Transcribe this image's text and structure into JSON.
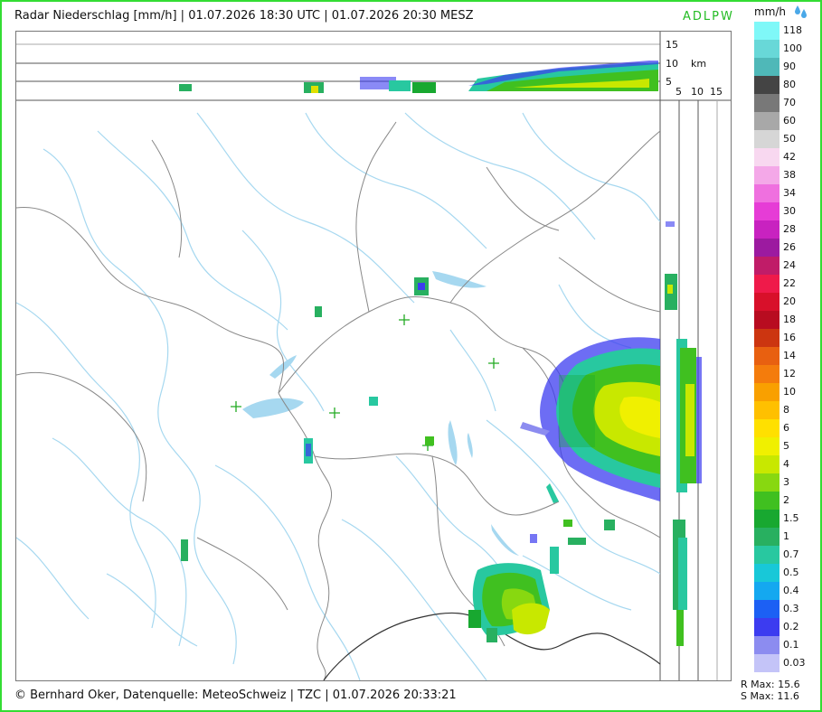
{
  "header": {
    "title": "Radar Niederschlag [mm/h] | 01.07.2026 18:30 UTC | 01.07.2026 20:30 MESZ",
    "brand": "ADLPW"
  },
  "legend": {
    "unit": "mm/h",
    "icon": "raindrops-icon",
    "entries": [
      {
        "label": "118",
        "color": "#7ff8f8"
      },
      {
        "label": "100",
        "color": "#68d8d8"
      },
      {
        "label": "90",
        "color": "#4fb8b8"
      },
      {
        "label": "80",
        "color": "#444444"
      },
      {
        "label": "70",
        "color": "#787878"
      },
      {
        "label": "60",
        "color": "#a8a8a8"
      },
      {
        "label": "50",
        "color": "#d6d6d6"
      },
      {
        "label": "42",
        "color": "#f8d8f0"
      },
      {
        "label": "38",
        "color": "#f4a8e8"
      },
      {
        "label": "34",
        "color": "#ef70df"
      },
      {
        "label": "30",
        "color": "#e63cd6"
      },
      {
        "label": "28",
        "color": "#c822c0"
      },
      {
        "label": "26",
        "color": "#9c1aa0"
      },
      {
        "label": "24",
        "color": "#c01c68"
      },
      {
        "label": "22",
        "color": "#ef1a4a"
      },
      {
        "label": "20",
        "color": "#d8102a"
      },
      {
        "label": "18",
        "color": "#b80c20"
      },
      {
        "label": "16",
        "color": "#cc3510"
      },
      {
        "label": "14",
        "color": "#e86010"
      },
      {
        "label": "12",
        "color": "#f47c0c"
      },
      {
        "label": "10",
        "color": "#f9a000"
      },
      {
        "label": "8",
        "color": "#ffc000"
      },
      {
        "label": "6",
        "color": "#ffe000"
      },
      {
        "label": "5",
        "color": "#f0f000"
      },
      {
        "label": "4",
        "color": "#c8e800"
      },
      {
        "label": "3",
        "color": "#88d810"
      },
      {
        "label": "2",
        "color": "#40c020"
      },
      {
        "label": "1.5",
        "color": "#18a830"
      },
      {
        "label": "1",
        "color": "#28b060"
      },
      {
        "label": "0.7",
        "color": "#28c8a0"
      },
      {
        "label": "0.5",
        "color": "#18c8d8"
      },
      {
        "label": "0.4",
        "color": "#14a8f0"
      },
      {
        "label": "0.3",
        "color": "#1c60f4"
      },
      {
        "label": "0.2",
        "color": "#3c3cf0"
      },
      {
        "label": "0.1",
        "color": "#8c8cf0"
      },
      {
        "label": "0.03",
        "color": "#c4c4f8"
      }
    ]
  },
  "profile_axes": {
    "top_ticks": [
      "15",
      "10",
      "5"
    ],
    "top_unit": "km",
    "side_ticks": [
      "5",
      "10",
      "15"
    ]
  },
  "stats": {
    "r_max": "R Max: 15.6",
    "s_max": "S Max: 11.6"
  },
  "footer": {
    "copyright": "© Bernhard Oker, Datenquelle: MeteoSchweiz | TZC | 01.07.2026 20:33:21"
  },
  "colors": {
    "frame": "#33dd33",
    "brand": "#22bb22",
    "river": "#a6d8f0",
    "border": "#888888",
    "radar_site": "#22aa22"
  }
}
